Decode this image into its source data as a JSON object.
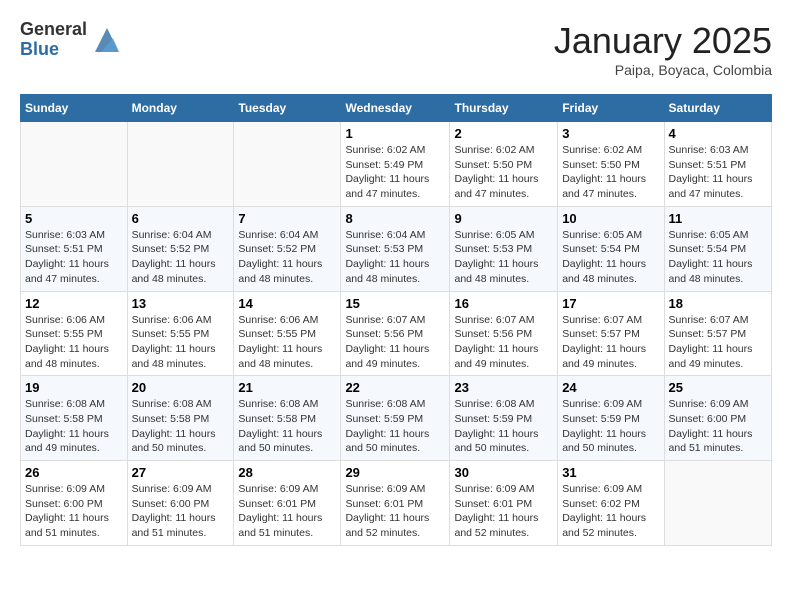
{
  "header": {
    "logo_general": "General",
    "logo_blue": "Blue",
    "title": "January 2025",
    "subtitle": "Paipa, Boyaca, Colombia"
  },
  "days_of_week": [
    "Sunday",
    "Monday",
    "Tuesday",
    "Wednesday",
    "Thursday",
    "Friday",
    "Saturday"
  ],
  "weeks": [
    [
      {
        "day": "",
        "info": ""
      },
      {
        "day": "",
        "info": ""
      },
      {
        "day": "",
        "info": ""
      },
      {
        "day": "1",
        "info": "Sunrise: 6:02 AM\nSunset: 5:49 PM\nDaylight: 11 hours and 47 minutes."
      },
      {
        "day": "2",
        "info": "Sunrise: 6:02 AM\nSunset: 5:50 PM\nDaylight: 11 hours and 47 minutes."
      },
      {
        "day": "3",
        "info": "Sunrise: 6:02 AM\nSunset: 5:50 PM\nDaylight: 11 hours and 47 minutes."
      },
      {
        "day": "4",
        "info": "Sunrise: 6:03 AM\nSunset: 5:51 PM\nDaylight: 11 hours and 47 minutes."
      }
    ],
    [
      {
        "day": "5",
        "info": "Sunrise: 6:03 AM\nSunset: 5:51 PM\nDaylight: 11 hours and 47 minutes."
      },
      {
        "day": "6",
        "info": "Sunrise: 6:04 AM\nSunset: 5:52 PM\nDaylight: 11 hours and 48 minutes."
      },
      {
        "day": "7",
        "info": "Sunrise: 6:04 AM\nSunset: 5:52 PM\nDaylight: 11 hours and 48 minutes."
      },
      {
        "day": "8",
        "info": "Sunrise: 6:04 AM\nSunset: 5:53 PM\nDaylight: 11 hours and 48 minutes."
      },
      {
        "day": "9",
        "info": "Sunrise: 6:05 AM\nSunset: 5:53 PM\nDaylight: 11 hours and 48 minutes."
      },
      {
        "day": "10",
        "info": "Sunrise: 6:05 AM\nSunset: 5:54 PM\nDaylight: 11 hours and 48 minutes."
      },
      {
        "day": "11",
        "info": "Sunrise: 6:05 AM\nSunset: 5:54 PM\nDaylight: 11 hours and 48 minutes."
      }
    ],
    [
      {
        "day": "12",
        "info": "Sunrise: 6:06 AM\nSunset: 5:55 PM\nDaylight: 11 hours and 48 minutes."
      },
      {
        "day": "13",
        "info": "Sunrise: 6:06 AM\nSunset: 5:55 PM\nDaylight: 11 hours and 48 minutes."
      },
      {
        "day": "14",
        "info": "Sunrise: 6:06 AM\nSunset: 5:55 PM\nDaylight: 11 hours and 48 minutes."
      },
      {
        "day": "15",
        "info": "Sunrise: 6:07 AM\nSunset: 5:56 PM\nDaylight: 11 hours and 49 minutes."
      },
      {
        "day": "16",
        "info": "Sunrise: 6:07 AM\nSunset: 5:56 PM\nDaylight: 11 hours and 49 minutes."
      },
      {
        "day": "17",
        "info": "Sunrise: 6:07 AM\nSunset: 5:57 PM\nDaylight: 11 hours and 49 minutes."
      },
      {
        "day": "18",
        "info": "Sunrise: 6:07 AM\nSunset: 5:57 PM\nDaylight: 11 hours and 49 minutes."
      }
    ],
    [
      {
        "day": "19",
        "info": "Sunrise: 6:08 AM\nSunset: 5:58 PM\nDaylight: 11 hours and 49 minutes."
      },
      {
        "day": "20",
        "info": "Sunrise: 6:08 AM\nSunset: 5:58 PM\nDaylight: 11 hours and 50 minutes."
      },
      {
        "day": "21",
        "info": "Sunrise: 6:08 AM\nSunset: 5:58 PM\nDaylight: 11 hours and 50 minutes."
      },
      {
        "day": "22",
        "info": "Sunrise: 6:08 AM\nSunset: 5:59 PM\nDaylight: 11 hours and 50 minutes."
      },
      {
        "day": "23",
        "info": "Sunrise: 6:08 AM\nSunset: 5:59 PM\nDaylight: 11 hours and 50 minutes."
      },
      {
        "day": "24",
        "info": "Sunrise: 6:09 AM\nSunset: 5:59 PM\nDaylight: 11 hours and 50 minutes."
      },
      {
        "day": "25",
        "info": "Sunrise: 6:09 AM\nSunset: 6:00 PM\nDaylight: 11 hours and 51 minutes."
      }
    ],
    [
      {
        "day": "26",
        "info": "Sunrise: 6:09 AM\nSunset: 6:00 PM\nDaylight: 11 hours and 51 minutes."
      },
      {
        "day": "27",
        "info": "Sunrise: 6:09 AM\nSunset: 6:00 PM\nDaylight: 11 hours and 51 minutes."
      },
      {
        "day": "28",
        "info": "Sunrise: 6:09 AM\nSunset: 6:01 PM\nDaylight: 11 hours and 51 minutes."
      },
      {
        "day": "29",
        "info": "Sunrise: 6:09 AM\nSunset: 6:01 PM\nDaylight: 11 hours and 52 minutes."
      },
      {
        "day": "30",
        "info": "Sunrise: 6:09 AM\nSunset: 6:01 PM\nDaylight: 11 hours and 52 minutes."
      },
      {
        "day": "31",
        "info": "Sunrise: 6:09 AM\nSunset: 6:02 PM\nDaylight: 11 hours and 52 minutes."
      },
      {
        "day": "",
        "info": ""
      }
    ]
  ]
}
